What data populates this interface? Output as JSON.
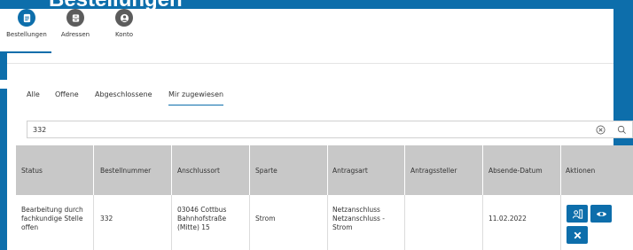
{
  "app": {
    "title_fragment": "Bestellungen"
  },
  "nav": {
    "items": [
      {
        "label": "Bestellungen",
        "icon": "document-icon"
      },
      {
        "label": "Adressen",
        "icon": "archive-box-icon"
      },
      {
        "label": "Konto",
        "icon": "user-icon"
      }
    ]
  },
  "tabs": [
    {
      "label": "Alle"
    },
    {
      "label": "Offene"
    },
    {
      "label": "Abgeschlossene"
    },
    {
      "label": "Mir zugewiesen"
    }
  ],
  "search": {
    "value": "332"
  },
  "table": {
    "headers": [
      "Status",
      "Bestellnummer",
      "Anschlussort",
      "Sparte",
      "Antragsart",
      "Antragssteller",
      "Absende-Datum",
      "Aktionen"
    ],
    "rows": [
      {
        "status": "Bearbeitung durch\nfachkundige Stelle\noffen",
        "bestellnummer": "332",
        "anschlussort": "03046 Cottbus\nBahnhofstraße\n(Mitte) 15",
        "sparte": "Strom",
        "antragsart": "Netzanschluss\nNetzanschluss -\nStrom",
        "antragssteller": "",
        "absende_datum": "11.02.2022"
      }
    ]
  },
  "colors": {
    "accent": "#0d6eab",
    "header_bg": "#c8c8c8",
    "nav_inactive": "#5c5c5c"
  }
}
